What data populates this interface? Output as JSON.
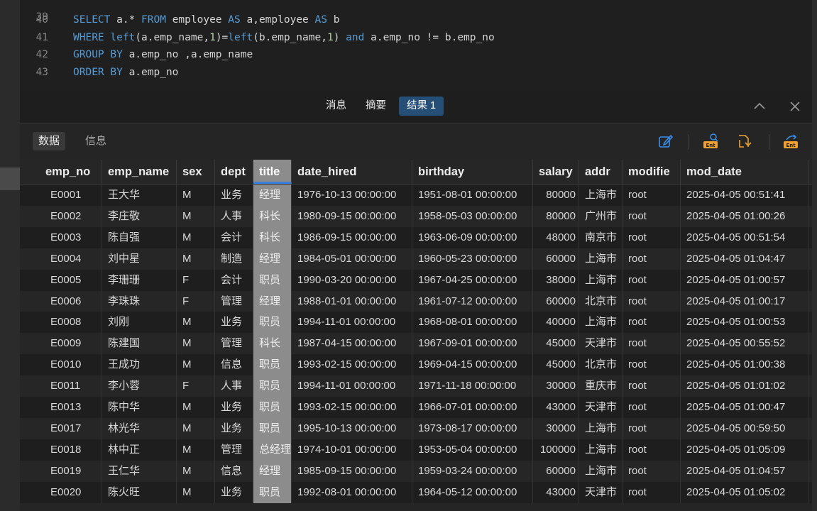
{
  "editor": {
    "partial_line": "39",
    "lines": [
      {
        "no": "40",
        "segments": [
          [
            "kw",
            "SELECT"
          ],
          [
            "t",
            " a.* "
          ],
          [
            "kw",
            "FROM"
          ],
          [
            "t",
            " employee "
          ],
          [
            "kw",
            "AS"
          ],
          [
            "t",
            " a,employee "
          ],
          [
            "kw",
            "AS"
          ],
          [
            "t",
            " b"
          ]
        ]
      },
      {
        "no": "41",
        "segments": [
          [
            "kw",
            "WHERE"
          ],
          [
            "t",
            " "
          ],
          [
            "fn",
            "left"
          ],
          [
            "t",
            "(a.emp_name,"
          ],
          [
            "num",
            "1"
          ],
          [
            "t",
            ")="
          ],
          [
            "fn",
            "left"
          ],
          [
            "t",
            "(b.emp_name,"
          ],
          [
            "num",
            "1"
          ],
          [
            "t",
            ") "
          ],
          [
            "kw",
            "and"
          ],
          [
            "t",
            " a.emp_no != b.emp_no"
          ]
        ]
      },
      {
        "no": "42",
        "segments": [
          [
            "kw",
            "GROUP BY"
          ],
          [
            "t",
            " a.emp_no ,a.emp_name"
          ]
        ]
      },
      {
        "no": "43",
        "segments": [
          [
            "kw",
            "ORDER BY"
          ],
          [
            "t",
            " a.emp_no"
          ]
        ]
      }
    ]
  },
  "result_tabs": [
    "消息",
    "摘要",
    "结果 1"
  ],
  "result_tabs_active": 2,
  "subtabs": [
    "数据",
    "信息"
  ],
  "subtabs_active": 0,
  "toolbar_icons": [
    "edit-icon",
    "export-icon",
    "refresh-icon",
    "import-icon"
  ],
  "columns": [
    "emp_no",
    "emp_name",
    "sex",
    "dept",
    "title",
    "date_hired",
    "birthday",
    "salary",
    "addr",
    "modifie",
    "mod_date"
  ],
  "rows": [
    [
      "E0001",
      "王大华",
      "M",
      "业务",
      "经理",
      "1976-10-13 00:00:00",
      "1951-08-01 00:00:00",
      "80000",
      "上海市",
      "root",
      "2025-04-05 00:51:41"
    ],
    [
      "E0002",
      "李庄敬",
      "M",
      "人事",
      "科长",
      "1980-09-15 00:00:00",
      "1958-05-03 00:00:00",
      "80000",
      "广州市",
      "root",
      "2025-04-05 01:00:26"
    ],
    [
      "E0003",
      "陈自强",
      "M",
      "会计",
      "科长",
      "1986-09-15 00:00:00",
      "1963-06-09 00:00:00",
      "48000",
      "南京市",
      "root",
      "2025-04-05 00:51:54"
    ],
    [
      "E0004",
      "刘中星",
      "M",
      "制造",
      "经理",
      "1984-05-01 00:00:00",
      "1960-05-23 00:00:00",
      "60000",
      "上海市",
      "root",
      "2025-04-05 01:04:47"
    ],
    [
      "E0005",
      "李珊珊",
      "F",
      "会计",
      "职员",
      "1990-03-20 00:00:00",
      "1967-04-25 00:00:00",
      "38000",
      "上海市",
      "root",
      "2025-04-05 01:00:57"
    ],
    [
      "E0006",
      "李珠珠",
      "F",
      "管理",
      "经理",
      "1988-01-01 00:00:00",
      "1961-07-12 00:00:00",
      "60000",
      "北京市",
      "root",
      "2025-04-05 01:00:17"
    ],
    [
      "E0008",
      "刘刚",
      "M",
      "业务",
      "职员",
      "1994-11-01 00:00:00",
      "1968-08-01 00:00:00",
      "40000",
      "上海市",
      "root",
      "2025-04-05 01:00:53"
    ],
    [
      "E0009",
      "陈建国",
      "M",
      "管理",
      "科长",
      "1987-04-15 00:00:00",
      "1967-09-01 00:00:00",
      "45000",
      "天津市",
      "root",
      "2025-04-05 00:55:52"
    ],
    [
      "E0010",
      "王成功",
      "M",
      "信息",
      "职员",
      "1993-02-15 00:00:00",
      "1969-04-15 00:00:00",
      "45000",
      "北京市",
      "root",
      "2025-04-05 01:00:38"
    ],
    [
      "E0011",
      "李小蓉",
      "F",
      "人事",
      "职员",
      "1994-11-01 00:00:00",
      "1971-11-18 00:00:00",
      "30000",
      "重庆市",
      "root",
      "2025-04-05 01:01:02"
    ],
    [
      "E0013",
      "陈中华",
      "M",
      "业务",
      "职员",
      "1993-02-15 00:00:00",
      "1966-07-01 00:00:00",
      "43000",
      "天津市",
      "root",
      "2025-04-05 01:00:47"
    ],
    [
      "E0017",
      "林光华",
      "M",
      "业务",
      "职员",
      "1995-10-13 00:00:00",
      "1973-08-17 00:00:00",
      "30000",
      "上海市",
      "root",
      "2025-04-05 00:59:50"
    ],
    [
      "E0018",
      "林中正",
      "M",
      "管理",
      "总经理",
      "1974-10-01 00:00:00",
      "1953-05-04 00:00:00",
      "100000",
      "上海市",
      "root",
      "2025-04-05 01:05:09"
    ],
    [
      "E0019",
      "王仁华",
      "M",
      "信息",
      "经理",
      "1985-09-15 00:00:00",
      "1959-03-24 00:00:00",
      "60000",
      "上海市",
      "root",
      "2025-04-05 01:04:57"
    ],
    [
      "E0020",
      "陈火旺",
      "M",
      "业务",
      "职员",
      "1992-08-01 00:00:00",
      "1964-05-12 00:00:00",
      "43000",
      "天津市",
      "root",
      "2025-04-05 01:05:02"
    ]
  ],
  "colors": {
    "accent": "#264f78",
    "keyword": "#569cd6",
    "number": "#b5cea8",
    "selected_column": "#8c8c8c",
    "icon_orange": "#f0a030",
    "icon_blue": "#3b8ee8"
  }
}
